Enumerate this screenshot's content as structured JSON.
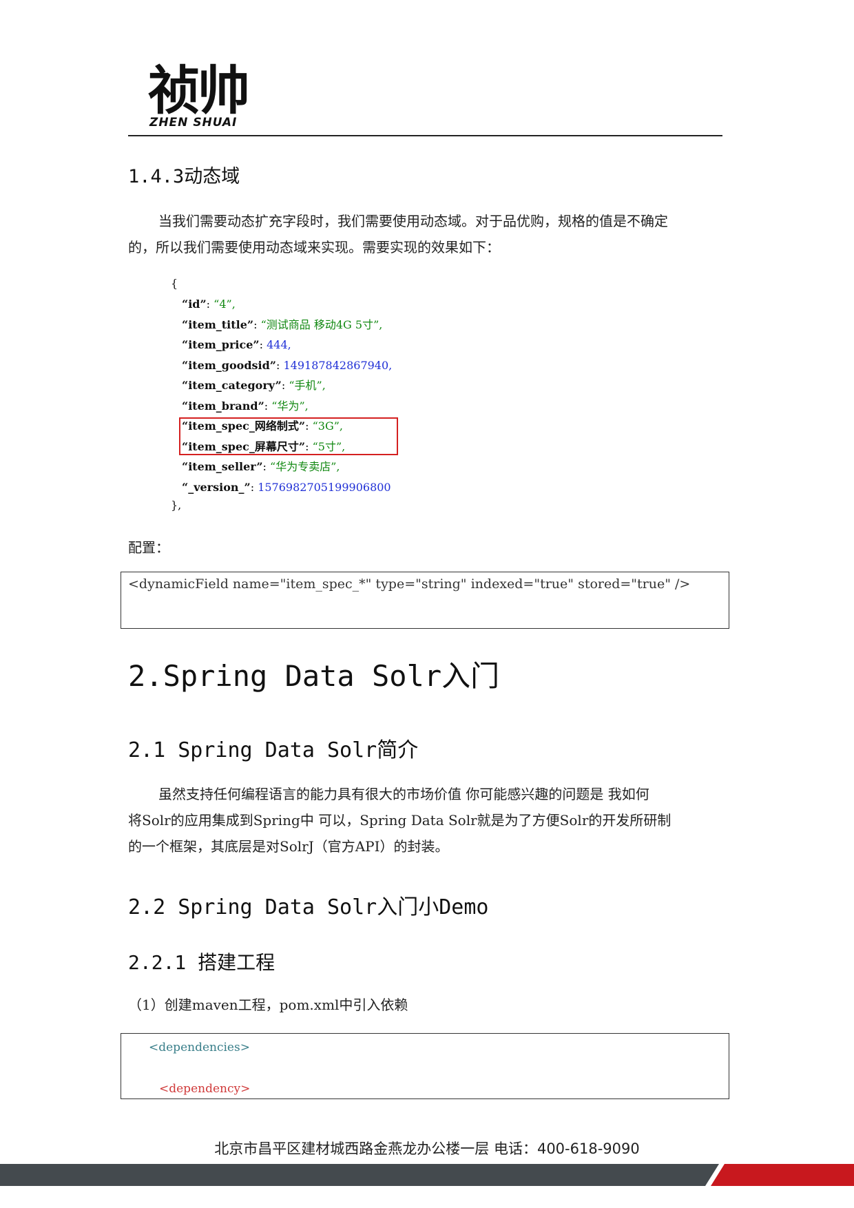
{
  "header": {
    "logo_cn": "祯帅",
    "logo_en": "ZHEN SHUAI"
  },
  "section_143": {
    "heading": "1.4.3动态域",
    "para_line1": "当我们需要动态扩充字段时，我们需要使用动态域。对于品优购，规格的值是不确定",
    "para_line2": "的，所以我们需要使用动态域来实现。需要实现的效果如下："
  },
  "json_example": {
    "open": "{",
    "close": "},",
    "lines": [
      {
        "key": "“id”",
        "sep": ": ",
        "value": "“4”,",
        "kind": "s"
      },
      {
        "key": "“item_title”",
        "sep": ": ",
        "value": "“测试商品  移动4G 5寸”,",
        "kind": "s"
      },
      {
        "key": "“item_price”",
        "sep": ": ",
        "value": "444,",
        "kind": "n"
      },
      {
        "key": "“item_goodsid”",
        "sep": ": ",
        "value": "149187842867940,",
        "kind": "n"
      },
      {
        "key": "“item_category”",
        "sep": ": ",
        "value": "“手机”,",
        "kind": "s"
      },
      {
        "key": "“item_brand”",
        "sep": ": ",
        "value": "“华为”,",
        "kind": "s"
      },
      {
        "key": "“item_spec_网络制式”",
        "sep": ": ",
        "value": "“3G”,",
        "kind": "s"
      },
      {
        "key": "“item_spec_屏幕尺寸”",
        "sep": ": ",
        "value": "“5寸”,",
        "kind": "s"
      },
      {
        "key": "“item_seller”",
        "sep": ": ",
        "value": "“华为专卖店”,",
        "kind": "s"
      },
      {
        "key": "“_version_”",
        "sep": ": ",
        "value": "1576982705199906800",
        "kind": "n"
      }
    ]
  },
  "config": {
    "label": "配置：",
    "code": "<dynamicField name=\"item_spec_*\" type=\"string\" indexed=\"true\" stored=\"true\" />"
  },
  "section_2": {
    "heading": "2.Spring Data Solr入门"
  },
  "section_21": {
    "heading": "2.1 Spring Data Solr简介",
    "line1": "虽然支持任何编程语言的能力具有很大的市场价值  你可能感兴趣的问题是  我如何",
    "line2": "将Solr的应用集成到Spring中  可以，Spring  Data  Solr就是为了方便Solr的开发所研制",
    "line3": "的一个框架，其底层是对SolrJ（官方API）的封装。"
  },
  "section_22": {
    "heading": "2.2 Spring Data Solr入门小Demo"
  },
  "section_221": {
    "heading": "2.2.1 搭建工程",
    "step1": "（1）创建maven工程，pom.xml中引入依赖"
  },
  "pom_code": {
    "line1": "<dependencies>",
    "line2": "<dependency>"
  },
  "footer": {
    "text": "北京市昌平区建材城西路金燕龙办公楼一层   电话：400-618-9090",
    "bar_dark": "#444a4e",
    "bar_red": "#c8181e"
  }
}
